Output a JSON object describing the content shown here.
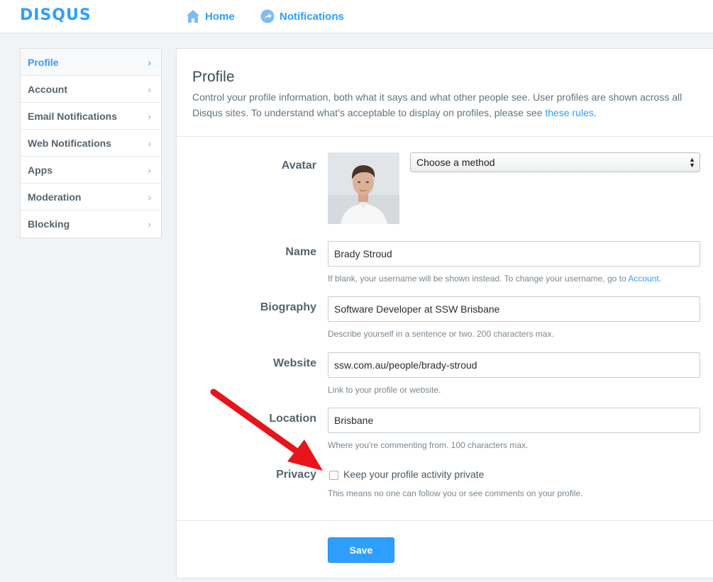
{
  "brand": {
    "name": "DISQUS",
    "color": "#2e9fff"
  },
  "topnav": {
    "home": {
      "label": "Home",
      "icon": "home-icon"
    },
    "notifications": {
      "label": "Notifications",
      "icon": "notifications-icon"
    }
  },
  "sidebar": {
    "items": [
      {
        "label": "Profile",
        "active": true
      },
      {
        "label": "Account"
      },
      {
        "label": "Email Notifications"
      },
      {
        "label": "Web Notifications"
      },
      {
        "label": "Apps"
      },
      {
        "label": "Moderation"
      },
      {
        "label": "Blocking"
      }
    ],
    "chevron": "›"
  },
  "main": {
    "title": "Profile",
    "description": "Control your profile information, both what it says and what other people see. User profiles are shown across all Disqus sites. To understand what's acceptable to display on profiles, please see ",
    "rules_link": "these rules",
    "description_end": ".",
    "avatar": {
      "label": "Avatar",
      "select_value": "Choose a method"
    },
    "name": {
      "label": "Name",
      "value": "Brady Stroud",
      "help": "If blank, your username will be shown instead. To change your username, go to ",
      "help_link": "Account",
      "help_end": "."
    },
    "biography": {
      "label": "Biography",
      "value": "Software Developer at SSW Brisbane",
      "help": "Describe yourself in a sentence or two. 200 characters max."
    },
    "website": {
      "label": "Website",
      "value": "ssw.com.au/people/brady-stroud",
      "help": "Link to your profile or website."
    },
    "location": {
      "label": "Location",
      "value": "Brisbane",
      "help": "Where you're commenting from. 100 characters max."
    },
    "privacy": {
      "label": "Privacy",
      "checkbox_label": "Keep your profile activity private",
      "checked": false,
      "help": "This means no one can follow you or see comments on your profile."
    },
    "save_label": "Save"
  },
  "annotation": {
    "type": "red-arrow",
    "color": "#e8141c"
  }
}
